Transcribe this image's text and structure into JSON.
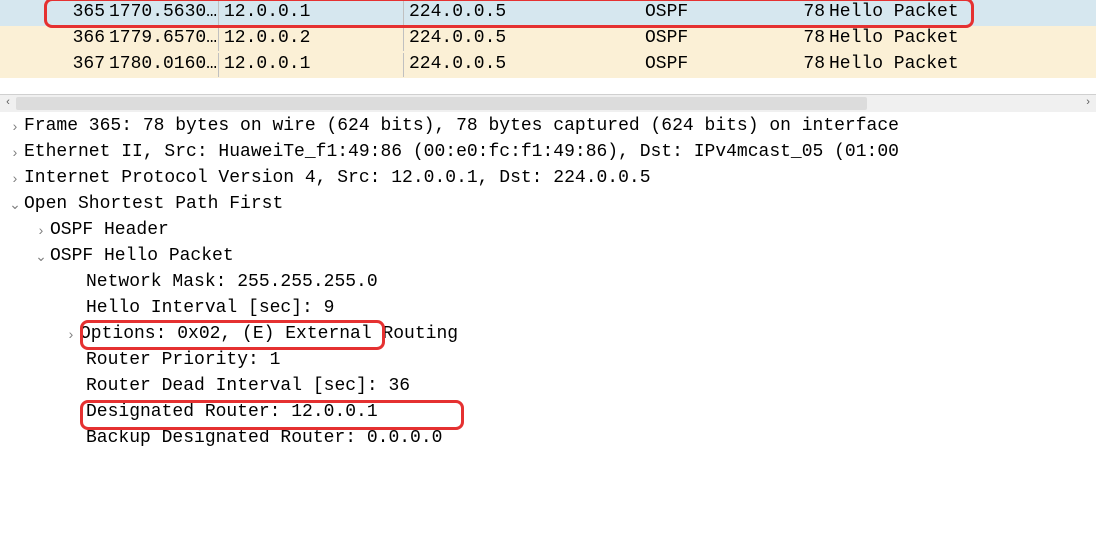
{
  "packets": [
    {
      "no": "365",
      "time": "1770.5630…",
      "src": "12.0.0.1",
      "dst": "224.0.0.5",
      "proto": "OSPF",
      "len": "78",
      "info": "Hello Packet",
      "selected": true
    },
    {
      "no": "366",
      "time": "1779.6570…",
      "src": "12.0.0.2",
      "dst": "224.0.0.5",
      "proto": "OSPF",
      "len": "78",
      "info": "Hello Packet",
      "selected": false
    },
    {
      "no": "367",
      "time": "1780.0160…",
      "src": "12.0.0.1",
      "dst": "224.0.0.5",
      "proto": "OSPF",
      "len": "78",
      "info": "Hello Packet",
      "selected": false
    }
  ],
  "details": {
    "frame": "Frame 365: 78 bytes on wire (624 bits), 78 bytes captured (624 bits) on interface",
    "ethernet": "Ethernet II, Src: HuaweiTe_f1:49:86 (00:e0:fc:f1:49:86), Dst: IPv4mcast_05 (01:00",
    "ip": "Internet Protocol Version 4, Src: 12.0.0.1, Dst: 224.0.0.5",
    "ospf": "Open Shortest Path First",
    "ospf_header": "OSPF Header",
    "ospf_hello": "OSPF Hello Packet",
    "netmask": "Network Mask: 255.255.255.0",
    "hello_interval": "Hello Interval [sec]: 9",
    "options": "Options: 0x02, (E) External Routing",
    "priority": "Router Priority: 1",
    "dead_interval": "Router Dead Interval [sec]: 36",
    "dr": "Designated Router: 12.0.0.1",
    "bdr": "Backup Designated Router: 0.0.0.0"
  },
  "glyphs": {
    "collapsed": "›",
    "expanded": "⌄",
    "scroll_left": "‹",
    "scroll_right": "›"
  }
}
